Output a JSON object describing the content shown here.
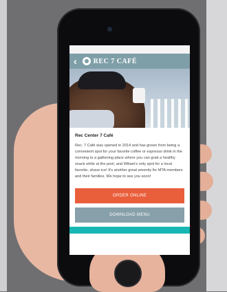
{
  "app": {
    "title": "REC 7 CAFÉ"
  },
  "content": {
    "heading": "Rec Center 7 Café",
    "description": "Rec. 7 Café was opened in 2014 and has grown from being a convenient spot for your favorite coffee or espresso drink in the morning to a gathering place where you can grab a healthy snack while at the pool, and Wiliam's only spot for a local favorite, shave ice! It's another great amenity for MTA members and their families. We hope to see you soon!"
  },
  "buttons": {
    "order_online": "ORDER ONLINE",
    "download_menu": "DOWNLOAD MENU"
  },
  "colors": {
    "nav": "#7f9fa8",
    "order": "#e95e3b",
    "menu": "#87a0a9",
    "teal": "#18b7b3"
  },
  "icons": {
    "back": "chevron-left-icon",
    "logo": "cafe-logo-icon"
  }
}
